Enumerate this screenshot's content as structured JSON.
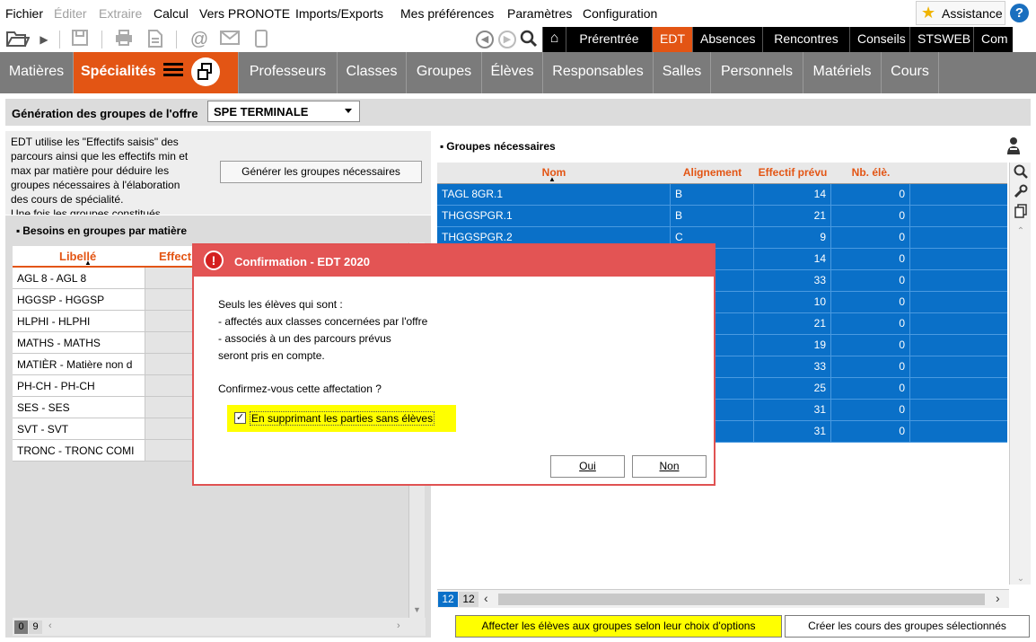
{
  "menu": {
    "items": [
      {
        "label": "Fichier",
        "disabled": false
      },
      {
        "label": "Éditer",
        "disabled": true
      },
      {
        "label": "Extraire",
        "disabled": true
      },
      {
        "label": "Calcul",
        "disabled": false
      },
      {
        "label": "Vers PRONOTE",
        "disabled": false
      },
      {
        "label": "Imports/Exports",
        "disabled": false
      },
      {
        "label": "Mes préférences",
        "disabled": false
      },
      {
        "label": "Paramètres",
        "disabled": false
      },
      {
        "label": "Configuration",
        "disabled": false
      }
    ],
    "assistance_label": "Assistance",
    "help_label": "?"
  },
  "modules": {
    "home_icon": "home-icon",
    "tabs": [
      "Prérentrée",
      "EDT",
      "Absences",
      "Rencontres",
      "Conseils",
      "STSWEB",
      "Com"
    ],
    "active": "EDT"
  },
  "subtabs": {
    "items": [
      "Matières",
      "Spécialités",
      "Professeurs",
      "Classes",
      "Groupes",
      "Élèves",
      "Responsables",
      "Salles",
      "Personnels",
      "Matériels",
      "Cours"
    ],
    "active": "Spécialités"
  },
  "generation": {
    "label": "Génération des groupes de l'offre",
    "selected": "SPE TERMINALE"
  },
  "left": {
    "info_lines": [
      "EDT utilise les \"Effectifs saisis\" des",
      "parcours ainsi que les effectifs min et",
      "max par matière pour déduire les",
      "groupes nécessaires à l'élaboration",
      "des cours de spécialité.",
      "Une fois les groupes constitués"
    ],
    "generate_button": "Générer les groupes nécessaires",
    "section_title": "Besoins en groupes par matière",
    "columns": [
      "Libellé",
      "Effect"
    ],
    "rows": [
      "AGL 8 - AGL 8",
      "HGGSP - HGGSP",
      "HLPHI - HLPHI",
      "MATHS - MATHS",
      "MATIÈR - Matière non d",
      "PH-CH - PH-CH",
      "SES - SES",
      "SVT - SVT",
      "TRONC - TRONC COMI"
    ],
    "count_total": "0",
    "count_selected": "9"
  },
  "right": {
    "section_title": "Groupes nécessaires",
    "columns": [
      "Nom",
      "Alignement",
      "Effectif prévu",
      "Nb. élè."
    ],
    "rows": [
      {
        "nom": "TAGL 8GR.1",
        "alignement": "B",
        "effectif": "14",
        "nb": "0"
      },
      {
        "nom": "THGGSPGR.1",
        "alignement": "B",
        "effectif": "21",
        "nb": "0"
      },
      {
        "nom": "THGGSPGR.2",
        "alignement": "C",
        "effectif": "9",
        "nb": "0"
      },
      {
        "nom": "",
        "alignement": "",
        "effectif": "14",
        "nb": "0"
      },
      {
        "nom": "",
        "alignement": "",
        "effectif": "33",
        "nb": "0"
      },
      {
        "nom": "",
        "alignement": "",
        "effectif": "10",
        "nb": "0"
      },
      {
        "nom": "",
        "alignement": "",
        "effectif": "21",
        "nb": "0"
      },
      {
        "nom": "",
        "alignement": "",
        "effectif": "19",
        "nb": "0"
      },
      {
        "nom": "",
        "alignement": "",
        "effectif": "33",
        "nb": "0"
      },
      {
        "nom": "",
        "alignement": "",
        "effectif": "25",
        "nb": "0"
      },
      {
        "nom": "",
        "alignement": "",
        "effectif": "31",
        "nb": "0"
      },
      {
        "nom": "",
        "alignement": "",
        "effectif": "31",
        "nb": "0"
      }
    ],
    "count_total": "12",
    "count_selected": "12",
    "assign_button": "Affecter les élèves aux groupes selon leur choix d'options",
    "create_button": "Créer les cours des groupes sélectionnés"
  },
  "dialog": {
    "title": "Confirmation - EDT 2020",
    "lines": [
      "Seuls les élèves qui sont :",
      "- affectés aux classes concernées par l'offre",
      "- associés à un des parcours prévus",
      "seront pris en compte."
    ],
    "question": "Confirmez-vous cette affectation ?",
    "checkbox_label": "En supprimant les parties sans élèves",
    "checkbox_checked": true,
    "yes_button": "Oui",
    "no_button": "Non"
  },
  "colors": {
    "accent": "#e35514",
    "selection": "#0a70c8",
    "dialog_title": "#e35454",
    "highlight": "#ffff00"
  }
}
